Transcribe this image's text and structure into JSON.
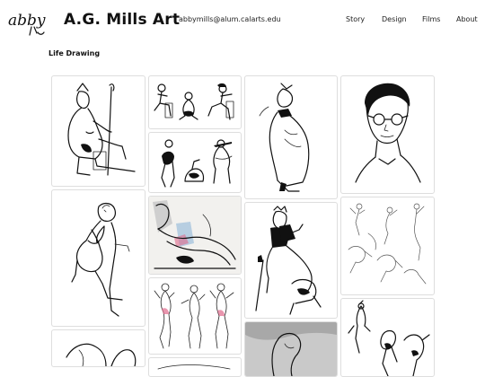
{
  "header": {
    "logo_text": "abby",
    "site_title": "A.G. Mills Art",
    "email": "abbymills@alum.calarts.edu",
    "nav": [
      {
        "label": "Story"
      },
      {
        "label": "Design"
      },
      {
        "label": "Films"
      },
      {
        "label": "About"
      }
    ]
  },
  "section": {
    "title": "Life Drawing"
  },
  "gallery": {
    "items": [
      {
        "subject": "seated-figure-with-staff"
      },
      {
        "subject": "group-of-seated-figures"
      },
      {
        "subject": "figures-with-bags"
      },
      {
        "subject": "reclining-figures-color"
      },
      {
        "subject": "gesture-figure-studies"
      },
      {
        "subject": "cloaked-figure-profile"
      },
      {
        "subject": "seated-costumed-figure"
      },
      {
        "subject": "grey-tone-figure"
      },
      {
        "subject": "portrait-with-glasses"
      },
      {
        "subject": "light-gesture-poses"
      },
      {
        "subject": "dynamic-figure-poses"
      },
      {
        "subject": "crouching-figure-study"
      },
      {
        "subject": "reclining-figure-sketch"
      }
    ]
  }
}
